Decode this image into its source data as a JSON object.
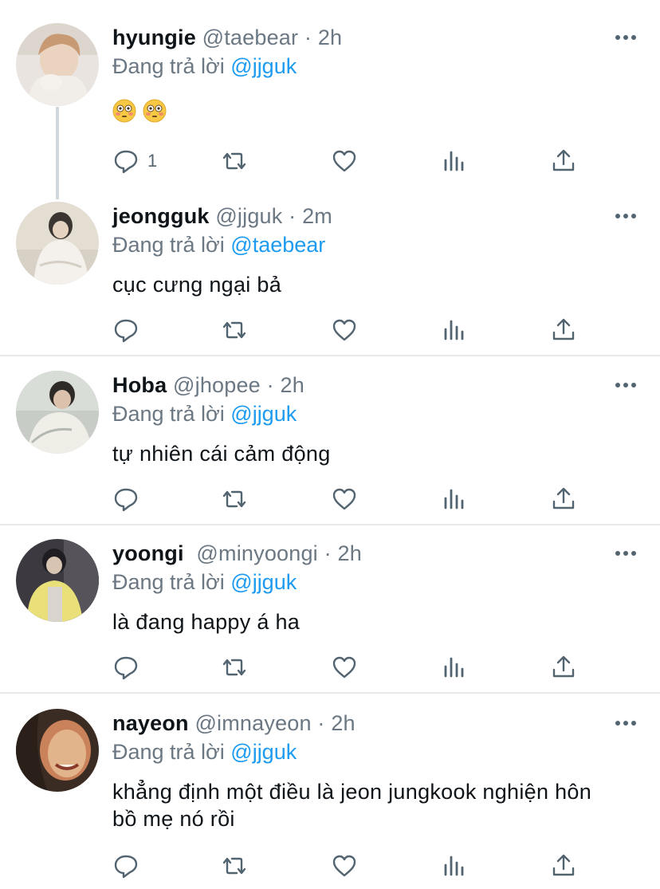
{
  "reply_prefix": "Đang trả lời",
  "tweets": [
    {
      "name": "hyungie",
      "handle": "@taebear",
      "dot": "·",
      "time": "2h",
      "replying_to": "@jjguk",
      "text": "",
      "emoji": [
        "flushed-face-emoji",
        "flushed-face-emoji"
      ],
      "reply_count": "1",
      "avatar_colors": [
        "#e9e4df",
        "#c89a74",
        "#f1ede8"
      ]
    },
    {
      "name": "jeongguk",
      "handle": "@jjguk",
      "dot": "·",
      "time": "2m",
      "replying_to": "@taebear",
      "text": "cục cưng ngại bả",
      "reply_count": "",
      "avatar_colors": [
        "#e4ddd2",
        "#3a3531",
        "#f4f1ec"
      ]
    },
    {
      "name": "Hoba",
      "handle": "@jhopee",
      "dot": "·",
      "time": "2h",
      "replying_to": "@jjguk",
      "text": "tự nhiên cái cảm động",
      "reply_count": "",
      "avatar_colors": [
        "#c7ccc6",
        "#2e2a27",
        "#efeee7"
      ]
    },
    {
      "name": "yoongi",
      "handle": "@minyoongi",
      "dot": "·",
      "time": "2h",
      "replying_to": "@jjguk",
      "text": "là đang happy á ha",
      "reply_count": "",
      "avatar_colors": [
        "#3c3a40",
        "#e9e07a",
        "#d9d4ce"
      ]
    },
    {
      "name": "nayeon",
      "handle": "@imnayeon",
      "dot": "·",
      "time": "2h",
      "replying_to": "@jjguk",
      "text": "khẳng định một điều là jeon jungkook nghiện hôn bồ mẹ nó rồi",
      "reply_count": "",
      "avatar_colors": [
        "#3a2c22",
        "#e2b48c",
        "#c9825a"
      ]
    }
  ],
  "colors": {
    "accent": "#1d9bf0",
    "muted": "#6b7782",
    "icon": "#536471",
    "divider": "#e7eaed"
  }
}
